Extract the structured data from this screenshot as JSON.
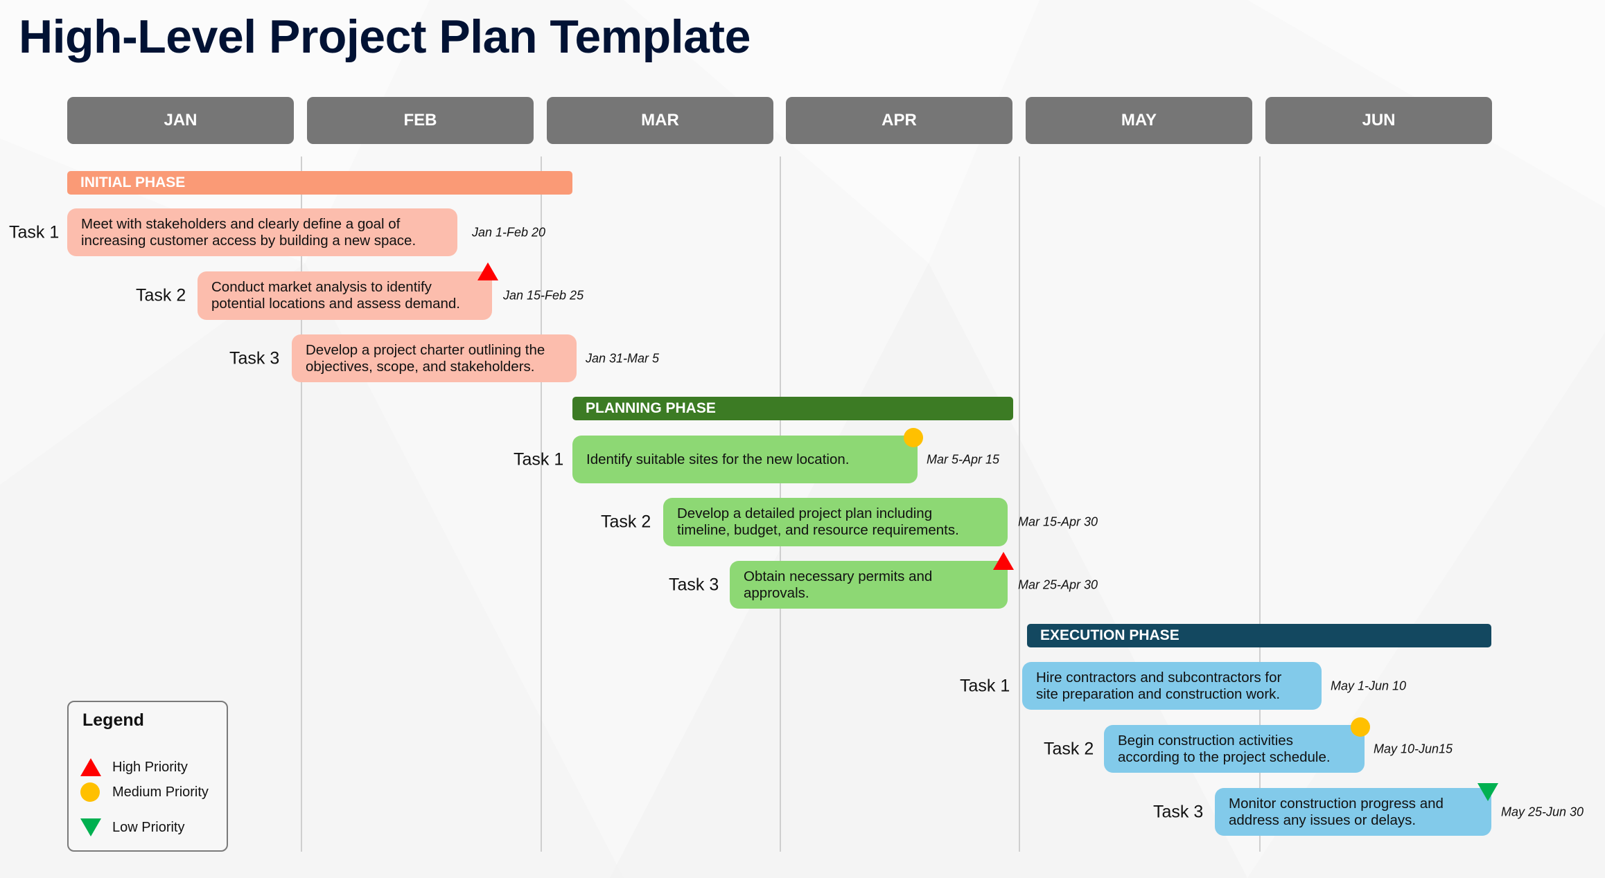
{
  "title": "High-Level Project Plan Template",
  "months": [
    "JAN",
    "FEB",
    "MAR",
    "APR",
    "MAY",
    "JUN"
  ],
  "colors": {
    "month_header": "#767676",
    "title": "#011234",
    "high_priority": "#ff0000",
    "medium_priority": "#ffc000",
    "low_priority": "#00b050"
  },
  "phases": [
    {
      "name": "INITIAL PHASE",
      "bar_color": "#fa9a76",
      "task_color": "#fcbdad",
      "tasks": [
        {
          "label": "Task 1",
          "line1": "Meet with stakeholders and clearly define a goal of",
          "line2": "increasing customer access by building a new space.",
          "dates": "Jan 1-Feb 20",
          "priority": null
        },
        {
          "label": "Task 2",
          "line1": "Conduct market analysis to identify",
          "line2": "potential locations and assess demand.",
          "dates": "Jan 15-Feb 25",
          "priority": "high"
        },
        {
          "label": "Task 3",
          "line1": "Develop a project charter outlining the",
          "line2": "objectives, scope, and stakeholders.",
          "dates": "Jan 31-Mar 5",
          "priority": null
        }
      ]
    },
    {
      "name": "PLANNING PHASE",
      "bar_color": "#3c7b24",
      "task_color": "#8dd874",
      "tasks": [
        {
          "label": "Task 1",
          "line1": "Identify suitable sites for the new location.",
          "line2": "",
          "dates": "Mar 5-Apr 15",
          "priority": "medium"
        },
        {
          "label": "Task 2",
          "line1": "Develop a detailed project plan including",
          "line2": "timeline, budget, and resource requirements.",
          "dates": "Mar 15-Apr 30",
          "priority": null
        },
        {
          "label": "Task 3",
          "line1": "Obtain necessary permits and",
          "line2": "approvals.",
          "dates": "Mar 25-Apr 30",
          "priority": "high"
        }
      ]
    },
    {
      "name": "EXECUTION PHASE",
      "bar_color": "#134860",
      "task_color": "#82caea",
      "tasks": [
        {
          "label": "Task 1",
          "line1": "Hire contractors and subcontractors for",
          "line2": "site preparation and construction work.",
          "dates": "May 1-Jun 10",
          "priority": null
        },
        {
          "label": "Task 2",
          "line1": "Begin construction activities",
          "line2": "according to the project schedule.",
          "dates": "May 10-Jun15",
          "priority": "medium"
        },
        {
          "label": "Task 3",
          "line1": "Monitor construction progress and",
          "line2": "address any issues or delays.",
          "dates": "May 25-Jun 30",
          "priority": "low"
        }
      ]
    }
  ],
  "legend": {
    "title": "Legend",
    "items": [
      {
        "label": "High Priority",
        "priority": "high"
      },
      {
        "label": "Medium Priority",
        "priority": "medium"
      },
      {
        "label": "Low Priority",
        "priority": "low"
      }
    ]
  },
  "chart_data": {
    "type": "gantt",
    "title": "High-Level Project Plan Template",
    "categories": [
      "JAN",
      "FEB",
      "MAR",
      "APR",
      "MAY",
      "JUN"
    ],
    "series": [
      {
        "name": "INITIAL PHASE",
        "tasks": [
          {
            "task": "Task 1",
            "start": "Jan 1",
            "end": "Feb 20",
            "priority": null
          },
          {
            "task": "Task 2",
            "start": "Jan 15",
            "end": "Feb 25",
            "priority": "High Priority"
          },
          {
            "task": "Task 3",
            "start": "Jan 31",
            "end": "Mar 5",
            "priority": null
          }
        ]
      },
      {
        "name": "PLANNING PHASE",
        "tasks": [
          {
            "task": "Task 1",
            "start": "Mar 5",
            "end": "Apr 15",
            "priority": "Medium Priority"
          },
          {
            "task": "Task 2",
            "start": "Mar 15",
            "end": "Apr 30",
            "priority": null
          },
          {
            "task": "Task 3",
            "start": "Mar 25",
            "end": "Apr 30",
            "priority": "High Priority"
          }
        ]
      },
      {
        "name": "EXECUTION PHASE",
        "tasks": [
          {
            "task": "Task 1",
            "start": "May 1",
            "end": "Jun 10",
            "priority": null
          },
          {
            "task": "Task 2",
            "start": "May 10",
            "end": "Jun 15",
            "priority": "Medium Priority"
          },
          {
            "task": "Task 3",
            "start": "May 25",
            "end": "Jun 30",
            "priority": "Low Priority"
          }
        ]
      }
    ],
    "legend": [
      "High Priority",
      "Medium Priority",
      "Low Priority"
    ],
    "legend_position": "bottom-left",
    "grid": true
  }
}
